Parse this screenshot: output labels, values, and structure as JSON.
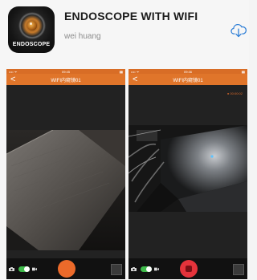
{
  "app": {
    "icon_label": "ENDOSCOPE",
    "title": "ENDOSCOPE WITH WIFI",
    "developer": "wei huang",
    "download_icon": "cloud-download-icon"
  },
  "screenshots": [
    {
      "nav_back": "<",
      "nav_title": "WIFI内窥镜01",
      "recording": false,
      "capture_mode": "photo"
    },
    {
      "nav_back": "<",
      "nav_title": "WIFI内窥镜01",
      "recording": true,
      "rec_indicator": "● 00:00:02",
      "capture_mode": "video"
    }
  ],
  "colors": {
    "accent": "#e0752a",
    "toggle_on": "#3fbb4b",
    "record_red": "#e5333b"
  }
}
